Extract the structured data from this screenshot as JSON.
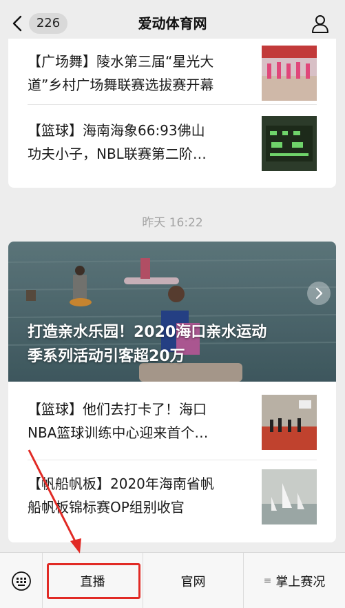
{
  "nav": {
    "back_count": "226",
    "title": "爱动体育网"
  },
  "feed_top": {
    "items": [
      {
        "line1": "【广场舞】陵水第三届“星光大",
        "line2": "道”乡村广场舞联赛选拔赛开幕",
        "thumb_icon": "dance-photo"
      },
      {
        "line1": "【篮球】海南海象66:93佛山",
        "line2": "功夫小子，NBL联赛第二阶…",
        "thumb_icon": "scoreboard-photo"
      }
    ]
  },
  "timestamp": "昨天 16:22",
  "feed_main": {
    "hero": {
      "line1": "打造亲水乐园！2020海口亲水运动",
      "line2": "季系列活动引客超20万",
      "image_icon": "beach-paddleboard-photo"
    },
    "items": [
      {
        "line1": "【篮球】他们去打卡了！海口",
        "line2": "NBA篮球训练中心迎来首个…",
        "thumb_icon": "basketball-court-photo"
      },
      {
        "line1": "【帆船帆板】2020年海南省帆",
        "line2": "船帆板锦标赛OP组别收官",
        "thumb_icon": "sailing-photo"
      }
    ]
  },
  "menu": {
    "live": "直播",
    "site": "官网",
    "events": "掌上赛况"
  },
  "colors": {
    "annotation_red": "#e12a25",
    "background": "#ededed"
  }
}
